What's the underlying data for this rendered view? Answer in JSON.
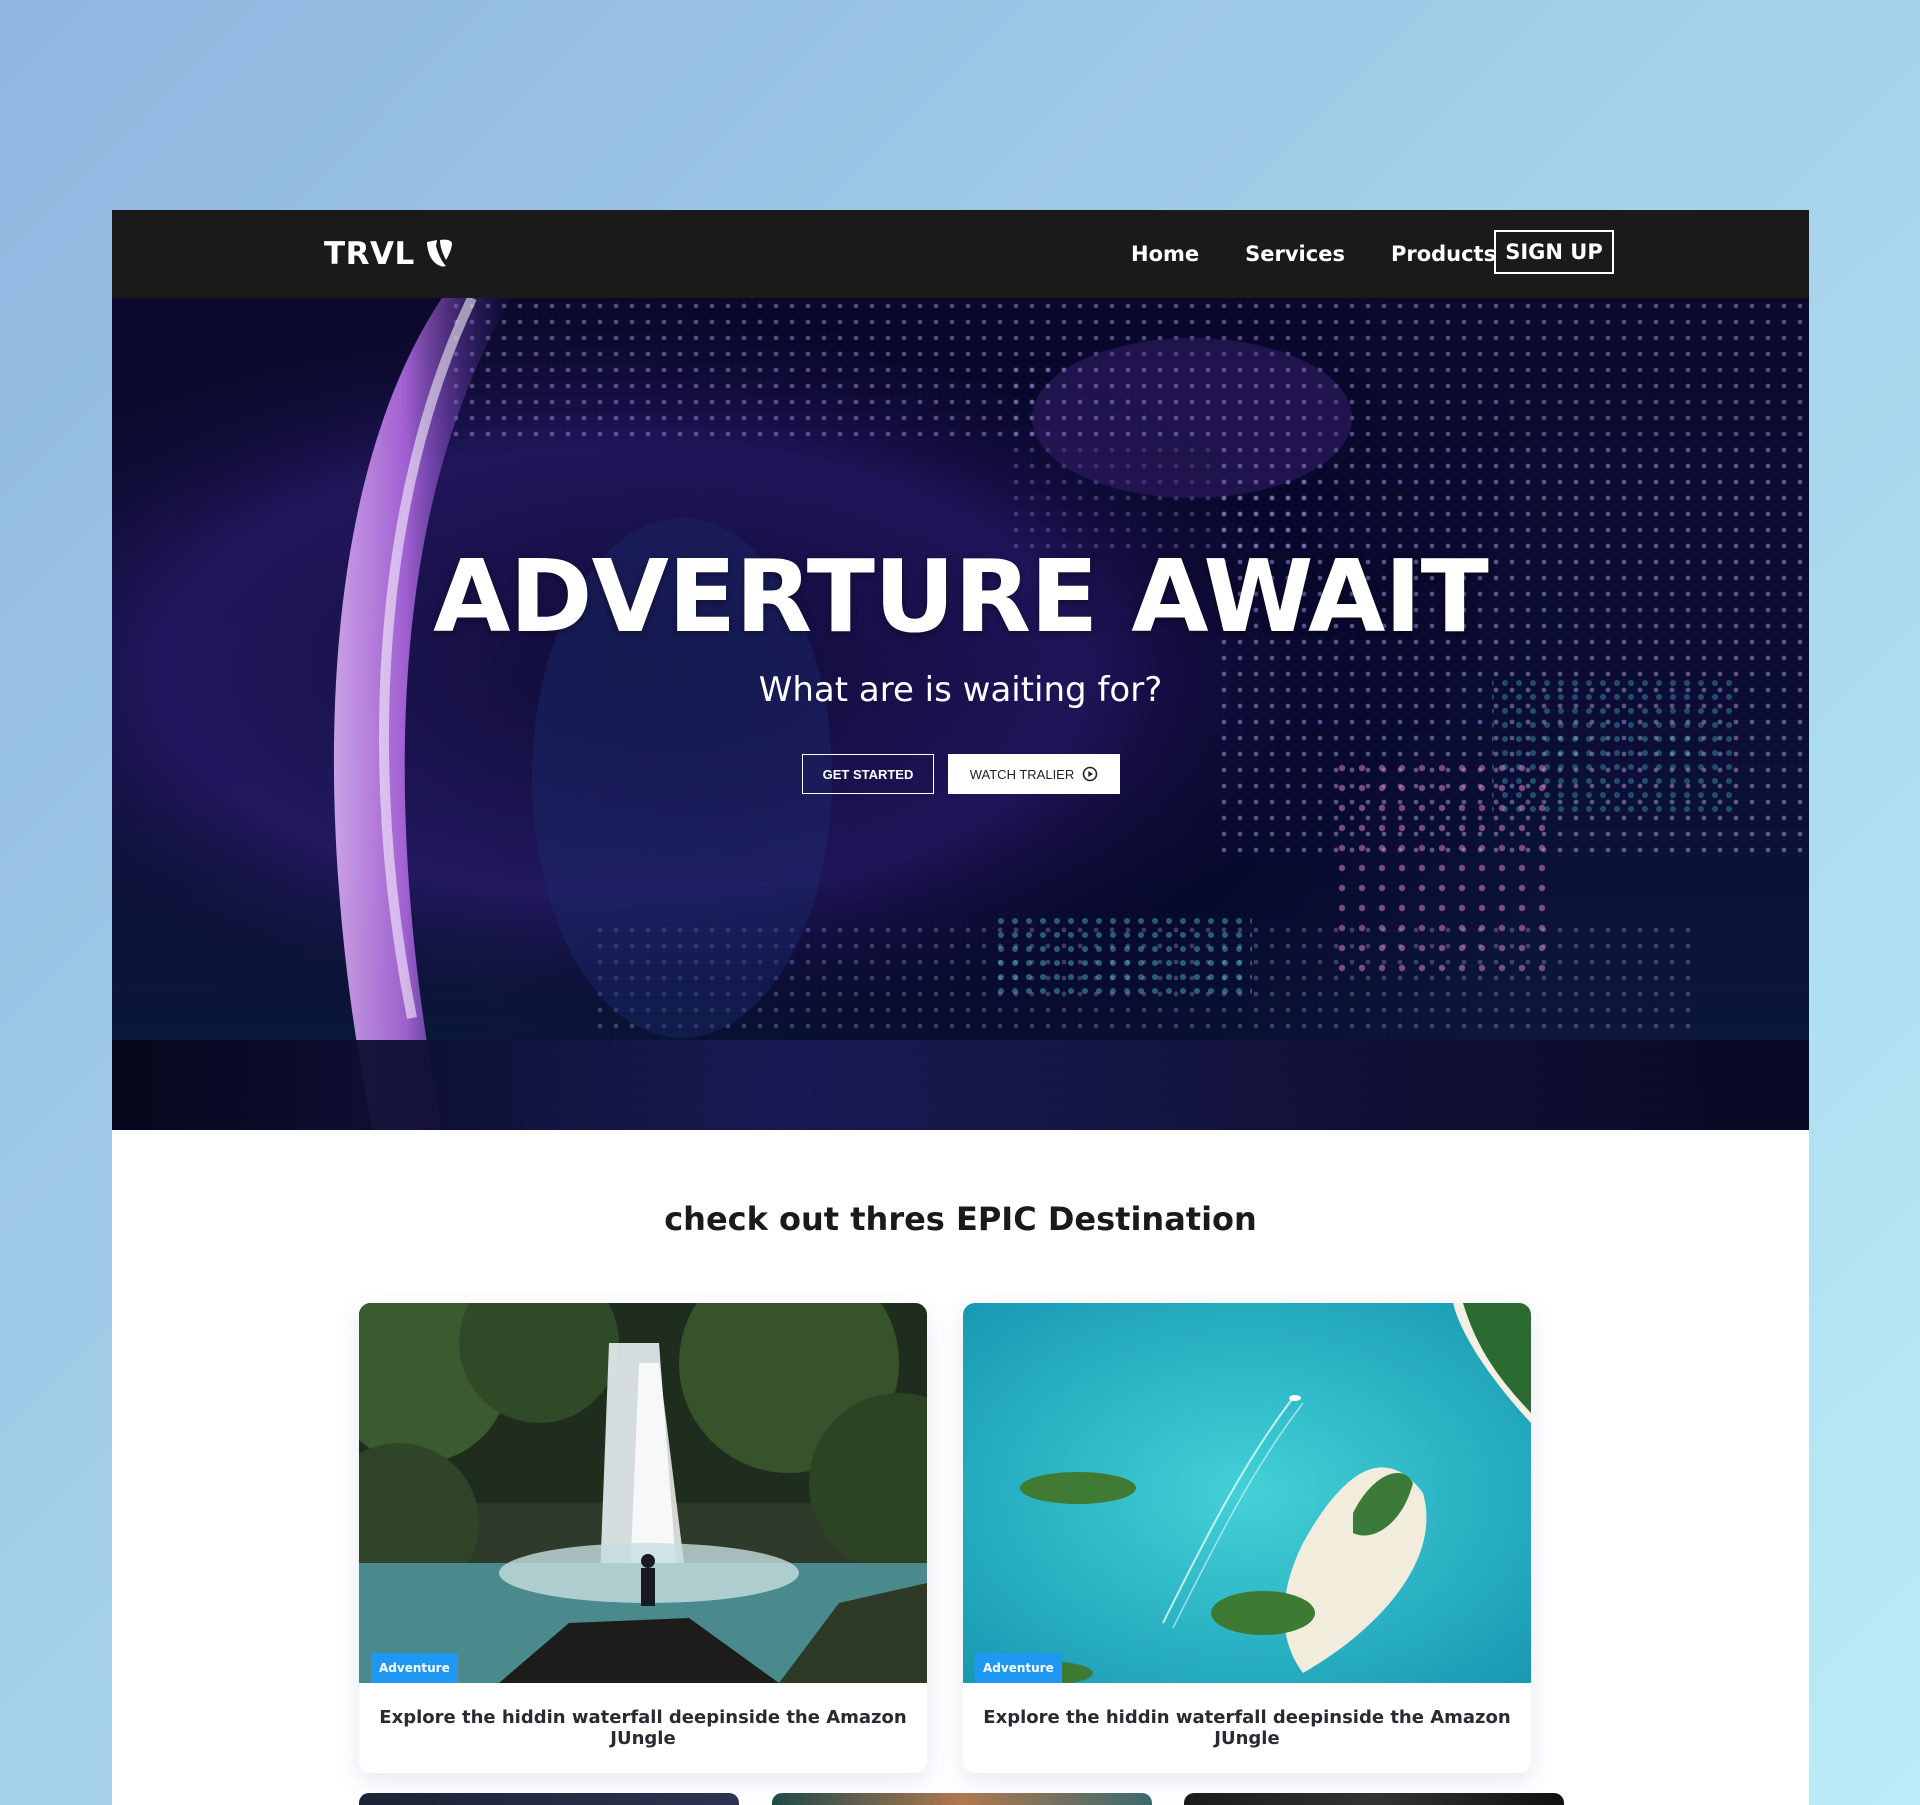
{
  "nav": {
    "logo": "TRVL",
    "links": [
      "Home",
      "Services",
      "Products"
    ],
    "signup": "SIGN UP"
  },
  "hero": {
    "title": "ADVERTURE AWAIT",
    "subtitle": "What are is waiting for?",
    "get_started": "GET STARTED",
    "watch_trailer": "WATCH TRALIER"
  },
  "destinations": {
    "title": "check out thres EPIC Destination",
    "cards": [
      {
        "badge": "Adventure",
        "text": "Explore the hiddin waterfall deepinside the Amazon JUngle"
      },
      {
        "badge": "Adventure",
        "text": "Explore the hiddin waterfall deepinside the Amazon JUngle"
      }
    ]
  },
  "colors": {
    "nav_bg": "#1b1a1a",
    "badge": "#1f98f4",
    "page_bg": "#a3cfe9"
  },
  "icons": {
    "logo_icon": "typo3-shield-icon",
    "play_icon": "play-circle-icon"
  }
}
